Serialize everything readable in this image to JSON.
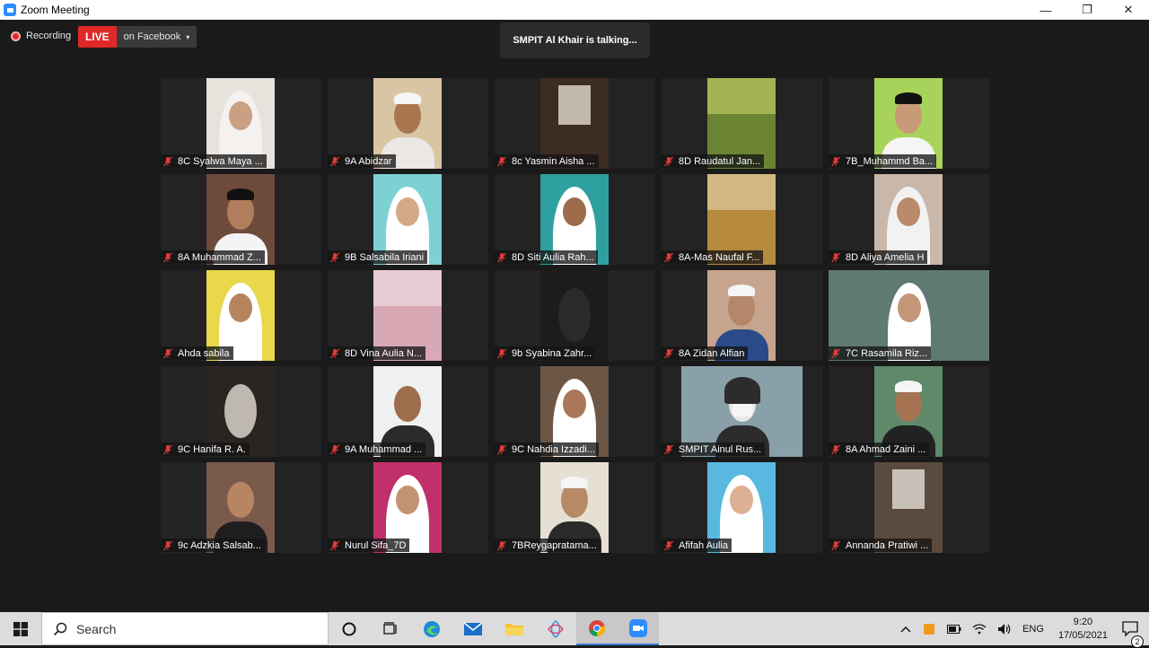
{
  "window": {
    "title": "Zoom Meeting",
    "minimize": "—",
    "restore": "❐",
    "close": "✕"
  },
  "toolbar": {
    "recording_label": "Recording",
    "live_label": "LIVE",
    "live_destination": "on Facebook",
    "caret": "▾"
  },
  "speaker_banner": "SMPIT Al Khair is talking...",
  "participants": [
    {
      "name": "8C Syalwa Maya ...",
      "bg": "#e8e2dc",
      "fg": "#f4f1ee",
      "skin": "#c8a083",
      "shape": "hijab"
    },
    {
      "name": "9A Abidzar",
      "bg": "#d9c4a3",
      "fg": "#eae7e5",
      "skin": "#a8774f",
      "shape": "cap"
    },
    {
      "name": "8c Yasmin Aisha ...",
      "bg": "#3d2c24",
      "fg": "#d9d0c4",
      "skin": "#6b4d3a",
      "shape": "window"
    },
    {
      "name": "8D Raudatul Jan...",
      "bg": "#6a8434",
      "fg": "#c8d46a",
      "skin": "#a4b550",
      "shape": "wall"
    },
    {
      "name": "7B_Muhammd Ba...",
      "bg": "#a8d35a",
      "fg": "#f5f5f5",
      "skin": "#c79a78",
      "shape": "cap"
    },
    {
      "name": "8A Muhammad Z...",
      "bg": "#6e4a3a",
      "fg": "#f4f4f4",
      "skin": "#b07d5d",
      "shape": "cap"
    },
    {
      "name": "9B Salsabila Iriani",
      "bg": "#7ed1d3",
      "fg": "#ffffff",
      "skin": "#d2a989",
      "shape": "hijab"
    },
    {
      "name": "8D Siti Aulia Rah...",
      "bg": "#2fa0a0",
      "fg": "#ffffff",
      "skin": "#9c6b4a",
      "shape": "hijab"
    },
    {
      "name": "8A-Mas Naufal F...",
      "bg": "#b68a3c",
      "fg": "#e6d6b0",
      "skin": "#8c6a3a",
      "shape": "wall"
    },
    {
      "name": "8D Aliya Amelia H",
      "bg": "#c9b8aa",
      "fg": "#f2f2f2",
      "skin": "#b98b6a",
      "shape": "hijab"
    },
    {
      "name": "Ahda sabila",
      "bg": "#e8d84a",
      "fg": "#ffffff",
      "skin": "#b58560",
      "shape": "hijab"
    },
    {
      "name": "8D Vina Aulia N...",
      "bg": "#d8a8b4",
      "fg": "#f1e2e6",
      "skin": "#c69a7c",
      "shape": "wall"
    },
    {
      "name": "9b Syabina Zahr...",
      "bg": "#1c1c1c",
      "fg": "#2a2a2a",
      "skin": "#2e2e2e",
      "shape": "dark"
    },
    {
      "name": "8A Zidan Alfian",
      "bg": "#c7a48d",
      "fg": "#2b4a8a",
      "skin": "#b5876a",
      "shape": "cap"
    },
    {
      "name": "7C Rasamila Riz...",
      "bg": "#5e7a72",
      "fg": "#ffffff",
      "skin": "#c29677",
      "shape": "hijab",
      "layout": "wide"
    },
    {
      "name": "9C Hanifa R. A.",
      "bg": "#2a2522",
      "fg": "#bfb8b0",
      "skin": "#3a3028",
      "shape": "dark"
    },
    {
      "name": "9A Muhammad ...",
      "bg": "#f0f0f0",
      "fg": "#2b2b2b",
      "skin": "#9e6e4c",
      "shape": "face"
    },
    {
      "name": "9C Nahdia Izzadi...",
      "bg": "#6c5646",
      "fg": "#ffffff",
      "skin": "#a9785a",
      "shape": "hijab"
    },
    {
      "name": "SMPIT Ainul Rus...",
      "bg": "#8aa0a8",
      "fg": "#2c2c2c",
      "skin": "#e8e8e8",
      "shape": "mask",
      "layout": "mid"
    },
    {
      "name": "8A Ahmad Zaini ...",
      "bg": "#5e8a6a",
      "fg": "#222222",
      "skin": "#a57252",
      "shape": "cap"
    },
    {
      "name": "9c Adzkia Salsab...",
      "bg": "#7a5a4a",
      "fg": "#1e1e1e",
      "skin": "#b88562",
      "shape": "face"
    },
    {
      "name": "Nurul Sifa_7D",
      "bg": "#c0306a",
      "fg": "#ffffff",
      "skin": "#c49274",
      "shape": "hijab"
    },
    {
      "name": "7BReygapratama...",
      "bg": "#e6e0d4",
      "fg": "#2a2a2a",
      "skin": "#b78a66",
      "shape": "cap"
    },
    {
      "name": "Afifah Aulia",
      "bg": "#58b8e0",
      "fg": "#ffffff",
      "skin": "#dcb095",
      "shape": "hijab"
    },
    {
      "name": "Annanda Pratiwi ...",
      "bg": "#5a4a3e",
      "fg": "#ddd6cc",
      "skin": "#3c3028",
      "shape": "window"
    }
  ],
  "taskbar": {
    "search_label": "Search",
    "language": "ENG",
    "time": "9:20",
    "date": "17/05/2021",
    "notification_count": "2"
  }
}
